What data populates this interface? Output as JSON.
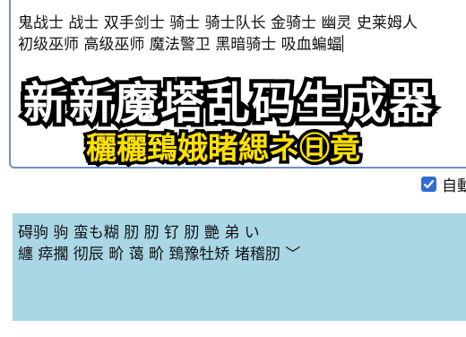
{
  "input": {
    "line1": "鬼战士  战士  双手剑士  骑士  骑士队长  金骑士  幽灵  史莱姆人",
    "line2": "初级巫师  高级巫师  魔法警卫  黑暗骑士  吸血蝙蝠"
  },
  "overlay": {
    "title": "新新魔塔乱码生成器",
    "subtitle": "穲穲鵄娥睹緦ネ㊐竟"
  },
  "options": {
    "auto_label": "自動",
    "auto_checked": true
  },
  "output": {
    "line1": "碍驹  驹  蛮も糊  肕  肕  钌  肕  艷  弟  い",
    "line2": "纏  瘁擱  彻辰    畍 蔼  畍 鵄豫牡矫 堵稽肕  ﹀"
  },
  "colors": {
    "input_border": "#6b8fc9",
    "output_bg": "#a9d7e6",
    "checkbox": "#2e6fd1",
    "subtitle": "#ffe100"
  }
}
